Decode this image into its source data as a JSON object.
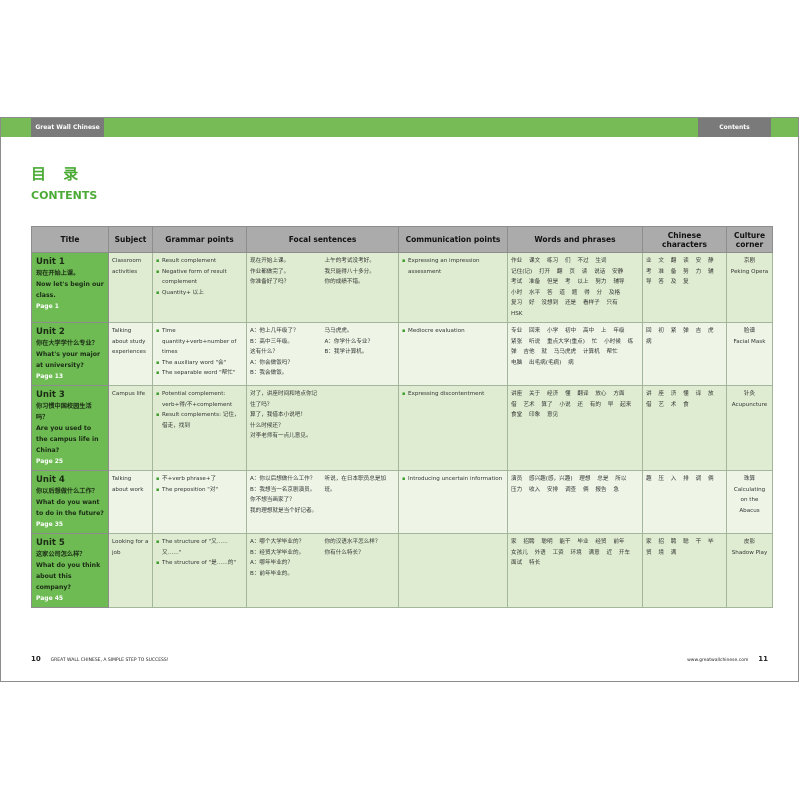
{
  "header": {
    "left_tab": "Great Wall Chinese",
    "right_tab": "Contents",
    "bar_color": "#77bb57",
    "tab_color": "#7a7a7a"
  },
  "page_title": {
    "cn": "目 录",
    "en": "CONTENTS",
    "color": "#4aaa35"
  },
  "table": {
    "headers": [
      "Title",
      "Subject",
      "Grammar points",
      "Focal  sentences",
      "Communication points",
      "Words and phrases",
      "Chinese characters",
      "Culture corner"
    ],
    "rows": [
      {
        "unit": "Unit 1",
        "title_cn": "现在开始上课。",
        "title_en": "Now let's begin our class.",
        "page": "Page 1",
        "subject": "Classroom activities",
        "grammar": [
          "Result complement",
          "Negative form of result complement",
          "Quantity+ 以上"
        ],
        "sentences_col1": [
          "现在开始上课。",
          "作业都做完了。",
          "你准备好了吗？"
        ],
        "sentences_col2": [
          "上午的考试没考好。",
          "我只能得八十多分。",
          "你的成绩不错。"
        ],
        "communication": [
          "Expressing an impression assessment"
        ],
        "words": [
          "作业",
          "课文",
          "练习",
          "们",
          "不过",
          "生词",
          "记住(记)",
          "打开",
          "翻",
          "页",
          "读",
          "说话",
          "安静",
          "考试",
          "准备",
          "但是",
          "考",
          "以上",
          "努力",
          "辅导",
          "小时",
          "水平",
          "答",
          "道",
          "题",
          "得",
          "分",
          "及格",
          "复习",
          "好",
          "没想到",
          "还是",
          "看样子",
          "只有",
          "HSK"
        ],
        "characters": [
          "业",
          "文",
          "翻",
          "读",
          "安",
          "静",
          "考",
          "准",
          "备",
          "努",
          "力",
          "辅",
          "导",
          "答",
          "及",
          "复"
        ],
        "culture_cn": "京剧",
        "culture_en": "Peking Opera"
      },
      {
        "unit": "Unit 2",
        "title_cn": "你在大学学什么专业？",
        "title_en": "What's your major at university?",
        "page": "Page 13",
        "subject": "Talking about study experiences",
        "grammar": [
          "Time quantity+verb+number of times",
          "The auxiliary word \"会\"",
          "The separable word \"帮忙\""
        ],
        "sentences_col1": [
          "A：他上几年级了？",
          "B：高中三年级。",
          "这有什么？",
          "A：你会做饭吗？",
          "B：我会做饭。"
        ],
        "sentences_col2": [
          "马马虎虎。",
          "A：你学什么专业？",
          "B：我学计算机。"
        ],
        "communication": [
          "Mediocre evaluation"
        ],
        "words": [
          "专业",
          "回来",
          "小学",
          "初中",
          "高中",
          "上",
          "年级",
          "紧张",
          "听说",
          "重点大学(重点)",
          "忙",
          "小时候",
          "练",
          "弹",
          "吉他",
          "就",
          "马马虎虎",
          "计算机",
          "帮忙",
          "电脑",
          "出毛病(毛病)",
          "病"
        ],
        "characters": [
          "回",
          "初",
          "紧",
          "弹",
          "吉",
          "虎",
          "病"
        ],
        "culture_cn": "脸谱",
        "culture_en": "Facial Mask"
      },
      {
        "unit": "Unit 3",
        "title_cn": "你习惯中国校园生活吗？",
        "title_en": "Are you used to the campus life in China?",
        "page": "Page 25",
        "subject": "Campus life",
        "grammar": [
          "Potential complement: verb+得/不+complement",
          "Result complements: 记住，借走，找到"
        ],
        "sentences_col1": [
          "对了，讲座时间和地点你记住了吗？",
          "算了，我借本小说吧！",
          "什么时候还？",
          "对李老师有一点儿意见。"
        ],
        "sentences_col2": [],
        "communication": [
          "Expressing discontentment"
        ],
        "words": [
          "讲座",
          "关于",
          "经济",
          "懂",
          "翻译",
          "放心",
          "方面",
          "借",
          "艺术",
          "算了",
          "小说",
          "还",
          "有的",
          "早",
          "起来",
          "食堂",
          "印象",
          "意见"
        ],
        "characters": [
          "讲",
          "座",
          "济",
          "懂",
          "译",
          "放",
          "借",
          "艺",
          "术",
          "食"
        ],
        "culture_cn": "针灸",
        "culture_en": "Acupuncture"
      },
      {
        "unit": "Unit 4",
        "title_cn": "你以后想做什么工作？",
        "title_en": "What do you want to do in the future?",
        "page": "Page 35",
        "subject": "Talking about work",
        "grammar": [
          "不+verb phrase+了",
          "The preposition \"对\""
        ],
        "sentences_col1": [
          "A：你以后想做什么工作？",
          "B：我想当一名京剧演员。",
          "你不想当画家了？",
          "我的理想就是当个好记者。"
        ],
        "sentences_col2": [
          "听说，在日本职员总是加班。"
        ],
        "communication": [
          "Introducing uncertain information"
        ],
        "words": [
          "演员",
          "感兴趣(感，兴趣)",
          "理想",
          "总是",
          "所以",
          "压力",
          "收入",
          "安排",
          "调查",
          "俩",
          "报告",
          "急"
        ],
        "characters": [
          "趣",
          "压",
          "入",
          "排",
          "调",
          "俩"
        ],
        "culture_cn": "珠算",
        "culture_en": "Calculating on the Abacus"
      },
      {
        "unit": "Unit 5",
        "title_cn": "这家公司怎么样？",
        "title_en": "What do you think about this company?",
        "page": "Page 45",
        "subject": "Looking for a job",
        "grammar": [
          "The structure of \"又……又……\"",
          "The structure of \"是……的\""
        ],
        "sentences_col1": [
          "A：哪个大学毕业的？",
          "B：经贸大学毕业的。",
          "A：哪年毕业的？",
          "B：前年毕业的。"
        ],
        "sentences_col2": [
          "你的汉语水平怎么样？",
          "你有什么特长？"
        ],
        "communication": [],
        "words": [
          "家",
          "招聘",
          "聪明",
          "能干",
          "毕业",
          "经贸",
          "前年",
          "女孩儿",
          "外语",
          "工资",
          "环境",
          "满意",
          "近",
          "开车",
          "面试",
          "特长"
        ],
        "characters": [
          "家",
          "招",
          "聘",
          "聪",
          "干",
          "毕",
          "贸",
          "境",
          "满"
        ],
        "culture_cn": "皮影",
        "culture_en": "Shadow Play"
      }
    ]
  },
  "footer": {
    "left_page": "10",
    "left_text": "GREAT WALL CHINESE, A SIMPLE STEP TO SUCCESS!",
    "right_text": "www.greatwallchinese.com",
    "right_page": "11"
  }
}
